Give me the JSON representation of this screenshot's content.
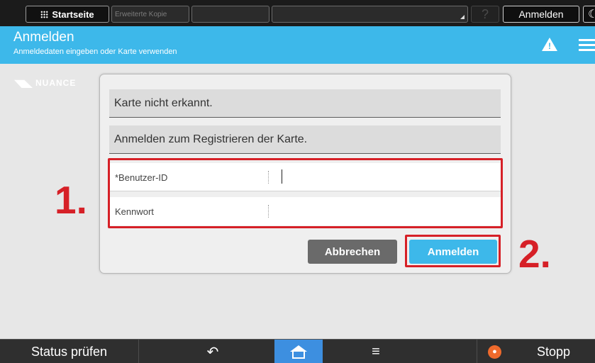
{
  "topbar": {
    "home_label": "Startseite",
    "copy_label": "Erweiterte Kopie",
    "help_label": "?",
    "login_label": "Anmelden",
    "moon_label": "☾"
  },
  "header": {
    "title": "Anmelden",
    "subtitle": "Anmeldedaten eingeben oder Karte verwenden",
    "warning_icon": "warning-icon",
    "menu_icon": "hamburger-menu-icon",
    "bg_color": "#3db8ea"
  },
  "logo": {
    "text": "NUANCE"
  },
  "dialog": {
    "message_1": "Karte nicht erkannt.",
    "message_2": "Anmelden zum Registrieren der Karte.",
    "user_id_label": "*Benutzer-ID",
    "user_id_value": "",
    "password_label": "Kennwort",
    "password_value": "",
    "cancel_label": "Abbrechen",
    "login_label": "Anmelden"
  },
  "annotations": {
    "step_1": "1.",
    "step_2": "2.",
    "color": "#d62027"
  },
  "bottombar": {
    "status_label": "Status prüfen",
    "back_icon": "↶",
    "menu_icon": "≡",
    "stop_label": "Stopp",
    "home_color": "#3d8fe0",
    "stop_color": "#ef6a2c"
  }
}
